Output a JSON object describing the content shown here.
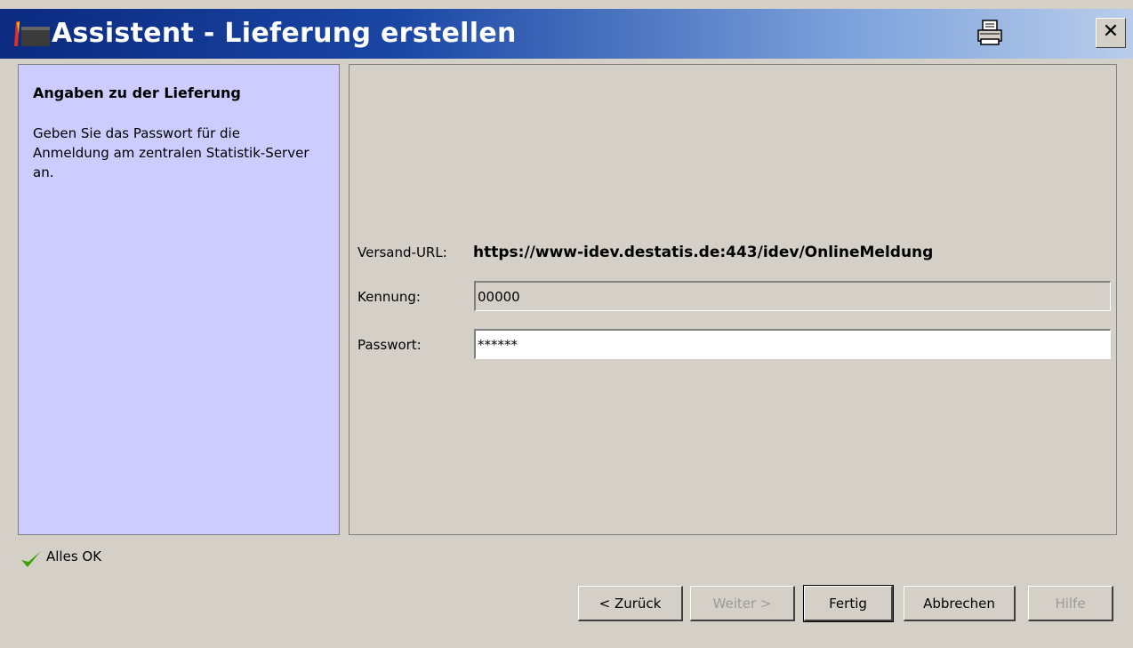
{
  "window": {
    "title": "Assistent - Lieferung erstellen"
  },
  "left": {
    "heading": "Angaben zu der Lieferung",
    "description": "Geben Sie das Passwort für die Anmeldung am zentralen Statistik-Server an."
  },
  "form": {
    "url_label": "Versand-URL:",
    "url_value": "https://www-idev.destatis.de:443/idev/OnlineMeldung",
    "kennung_label": "Kennung:",
    "kennung_value": "00000",
    "passwort_label": "Passwort:",
    "passwort_value": "******"
  },
  "status": {
    "text": "Alles OK"
  },
  "buttons": {
    "back": "< Zurück",
    "next": "Weiter >",
    "finish": "Fertig",
    "cancel": "Abbrechen",
    "help": "Hilfe"
  },
  "icons": {
    "title": "flag-icon",
    "print": "printer-icon",
    "close": "close-icon",
    "status": "checkmark-icon"
  },
  "colors": {
    "left_panel": "#ccccff",
    "check": "#3aa300"
  }
}
